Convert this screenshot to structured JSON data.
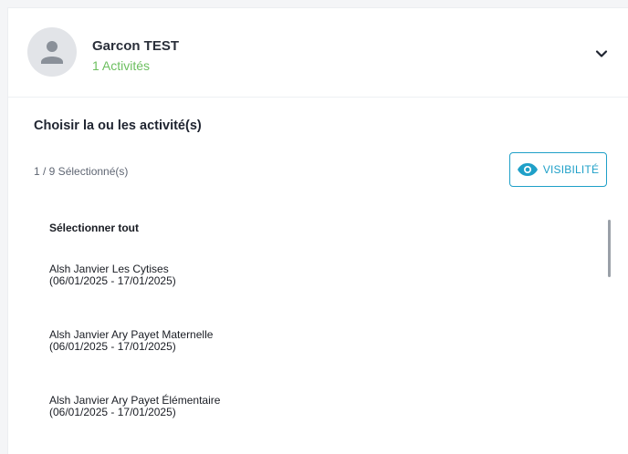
{
  "profile": {
    "name": "Garcon TEST",
    "activity_count": "1 Activités",
    "avatar_icon": "person-icon",
    "expand_icon": "chevron-down-icon"
  },
  "selection": {
    "title": "Choisir la ou les activité(s)",
    "count": "1 / 9 Sélectionné(s)",
    "visibility_button": "VISIBILITÉ",
    "visibility_icon": "eye-icon",
    "select_all": "Sélectionner tout"
  },
  "activities": [
    {
      "name": "Alsh Janvier Les Cytises",
      "dates": "(06/01/2025 - 17/01/2025)"
    },
    {
      "name": "Alsh Janvier Ary Payet Maternelle",
      "dates": "(06/01/2025 - 17/01/2025)"
    },
    {
      "name": "Alsh Janvier Ary Payet Élémentaire",
      "dates": "(06/01/2025 - 17/01/2025)"
    }
  ],
  "colors": {
    "accent": "#1fa0c8",
    "success": "#6cbf5f"
  }
}
